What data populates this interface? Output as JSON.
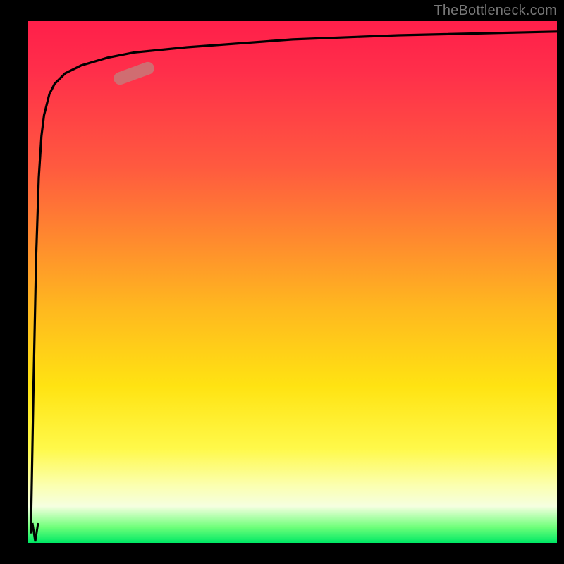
{
  "watermark": "TheBottleneck.com",
  "chart_data": {
    "type": "line",
    "title": "",
    "xlabel": "",
    "ylabel": "",
    "xlim": [
      0,
      100
    ],
    "ylim": [
      0,
      100
    ],
    "grid": false,
    "legend": false,
    "background_gradient": {
      "direction": "vertical",
      "stops": [
        {
          "pos": 0.0,
          "color": "#ff1f4a"
        },
        {
          "pos": 0.28,
          "color": "#ff5a3f"
        },
        {
          "pos": 0.55,
          "color": "#ffb81f"
        },
        {
          "pos": 0.82,
          "color": "#fff94a"
        },
        {
          "pos": 0.93,
          "color": "#f5ffe0"
        },
        {
          "pos": 1.0,
          "color": "#00e865"
        }
      ]
    },
    "series": [
      {
        "name": "bottleneck-curve",
        "color": "#000000",
        "x": [
          0.5,
          1,
          1.5,
          2,
          2.5,
          3,
          4,
          5,
          7,
          10,
          15,
          20,
          30,
          50,
          70,
          100
        ],
        "y": [
          2,
          30,
          55,
          70,
          78,
          82,
          86,
          88,
          90,
          91.5,
          93,
          94,
          95,
          96.5,
          97.3,
          98
        ]
      }
    ],
    "marker": {
      "description": "highlighted segment on curve",
      "x_center": 20,
      "y_center": 90,
      "color": "#c88878"
    }
  }
}
